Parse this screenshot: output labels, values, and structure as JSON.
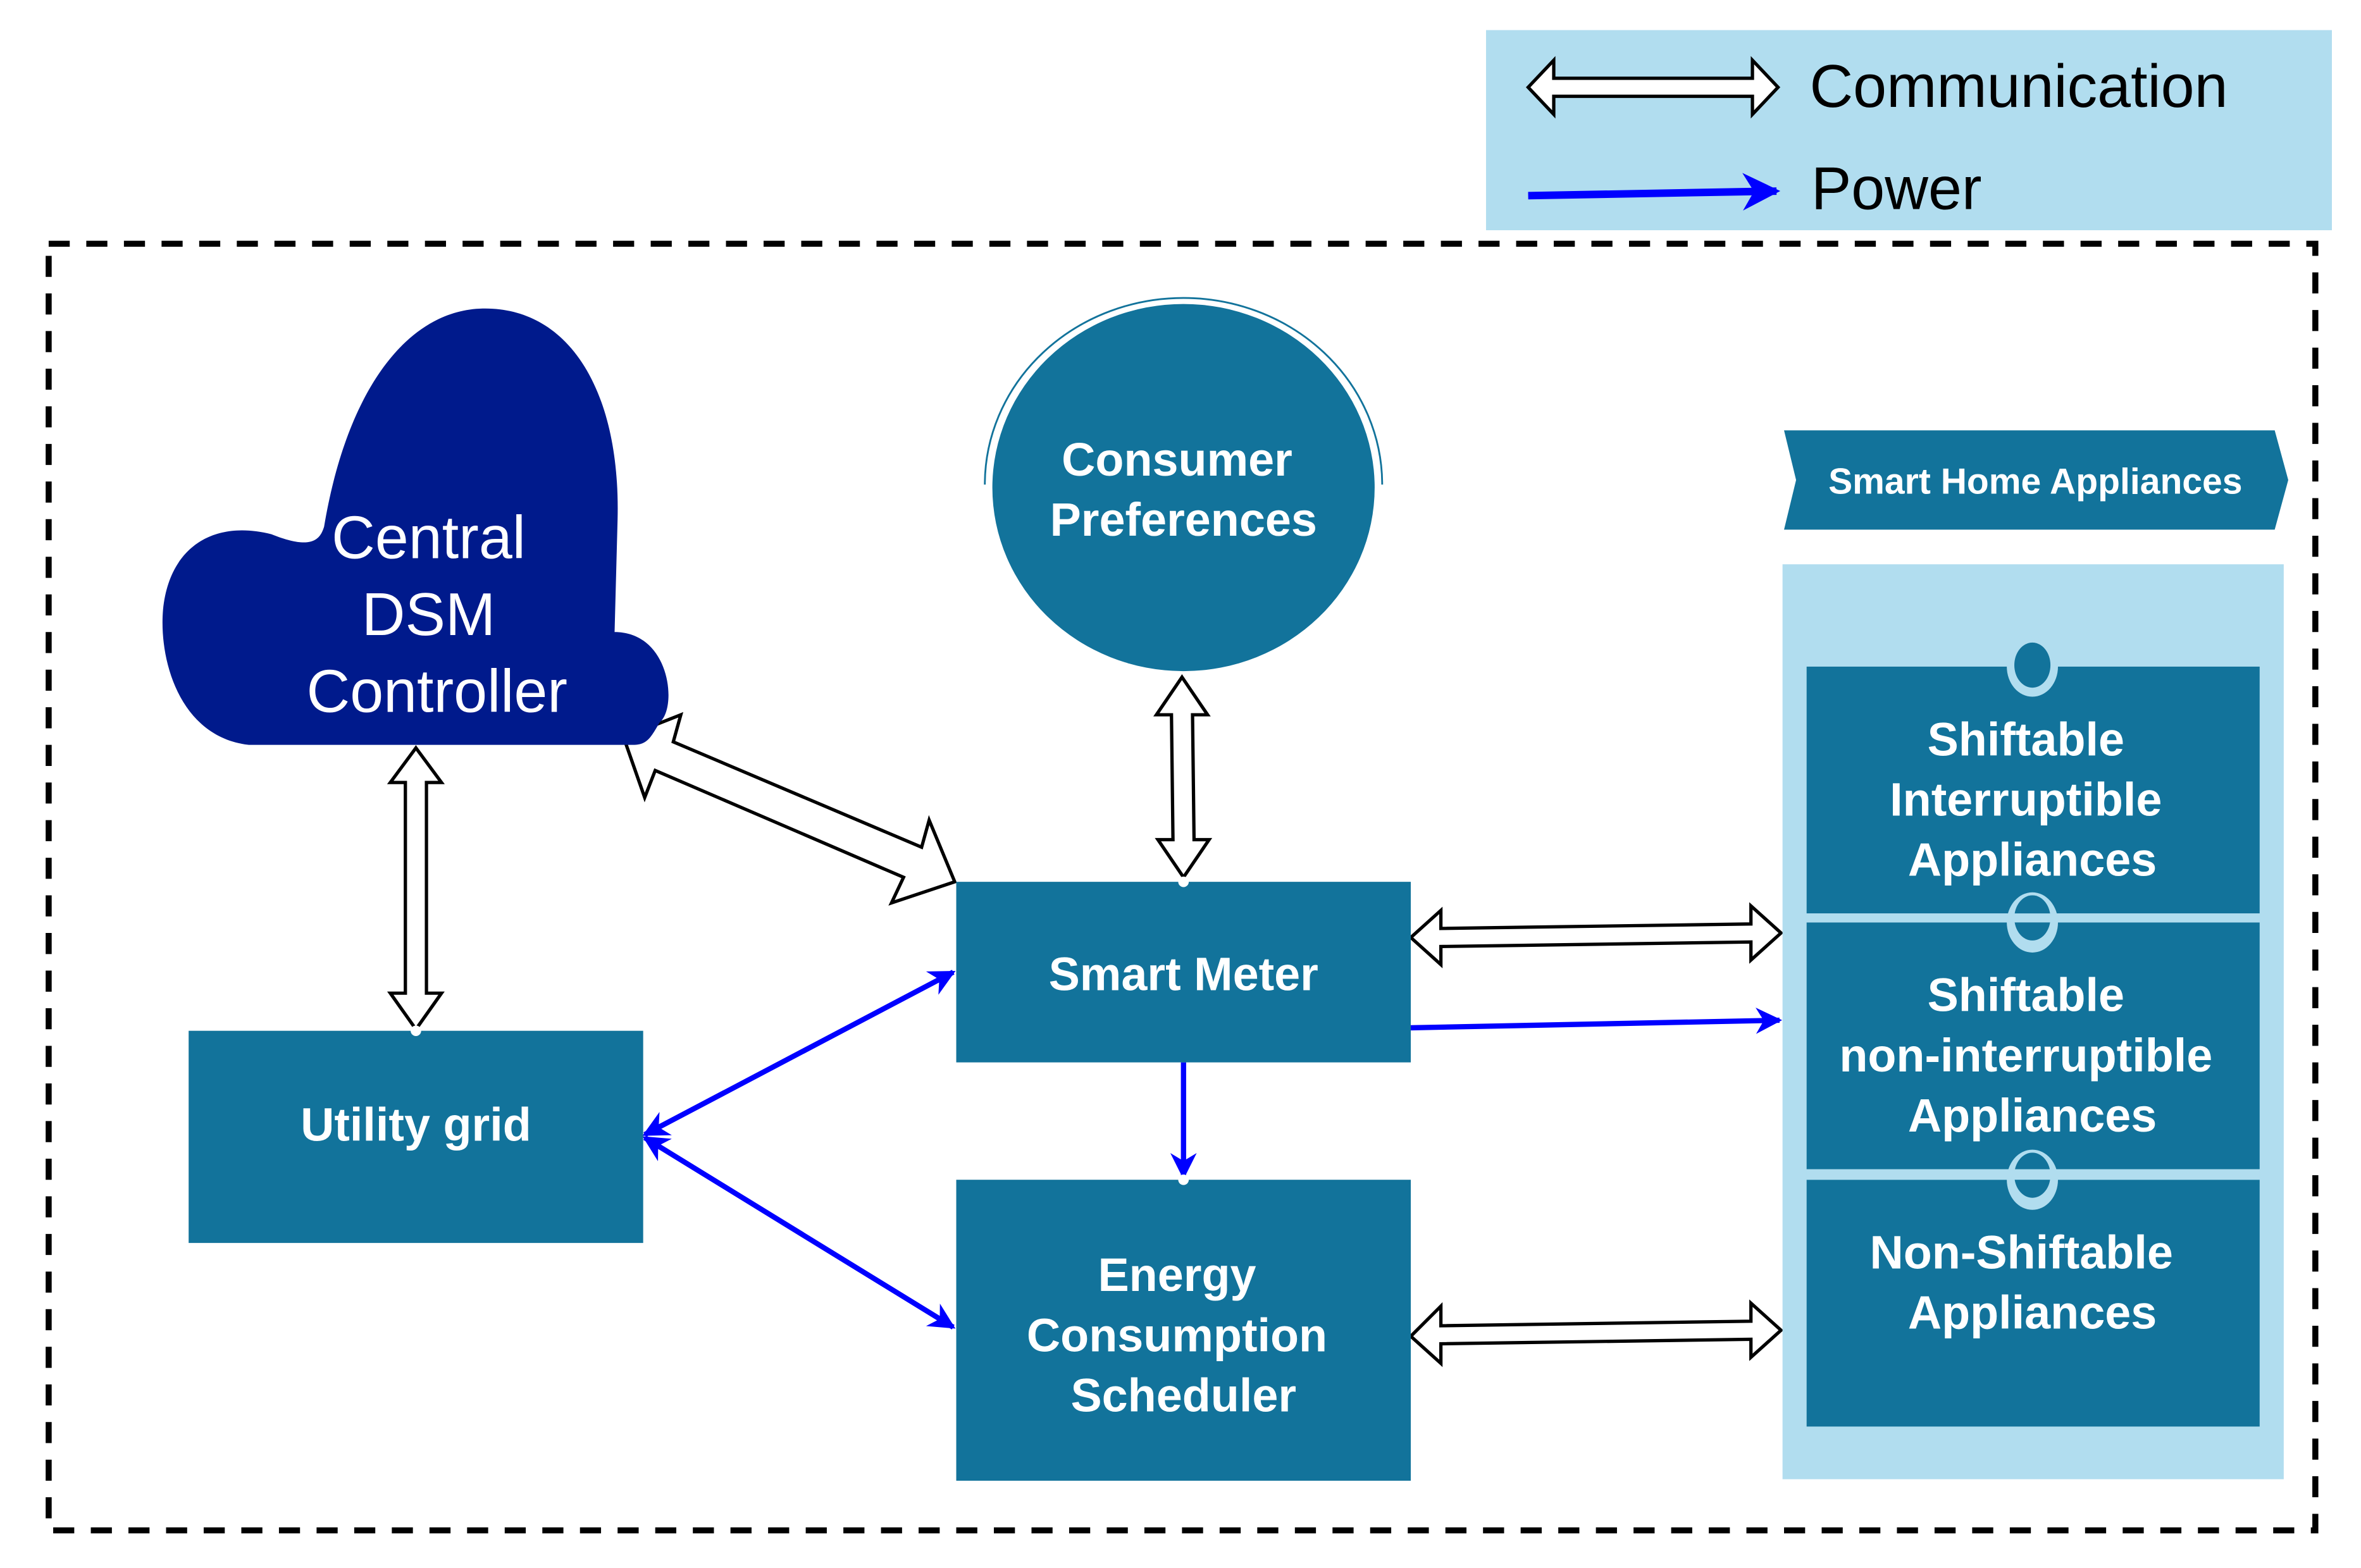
{
  "colors": {
    "box_fill": "#12739b",
    "cloud_fill": "#001a8c",
    "light_panel": "#b1ddef",
    "power_arrow": "#0000ff",
    "comm_arrow_stroke": "#000000",
    "text_white": "#ffffff",
    "text_black": "#000000"
  },
  "legend": {
    "communication_label": "Communication",
    "power_label": "Power"
  },
  "nodes": {
    "central_controller": {
      "lines": [
        "Central",
        "DSM",
        "Controller"
      ]
    },
    "consumer_preferences": {
      "lines": [
        "Consumer",
        "Preferences"
      ]
    },
    "smart_meter": {
      "lines": [
        "Smart Meter"
      ]
    },
    "utility_grid": {
      "lines": [
        "Utility grid"
      ]
    },
    "energy_scheduler": {
      "lines": [
        "Energy",
        "Consumption",
        "Scheduler"
      ]
    }
  },
  "appliances": {
    "header": "Smart Home Appliances",
    "items": [
      {
        "lines": [
          "Shiftable",
          "Interruptible",
          "Appliances"
        ]
      },
      {
        "lines": [
          "Shiftable",
          "non-interruptible",
          "Appliances"
        ]
      },
      {
        "lines": [
          "Non-Shiftable",
          "Appliances"
        ]
      }
    ]
  },
  "connections": [
    {
      "from": "central_controller",
      "to": "utility_grid",
      "type": "communication",
      "direction": "bidirectional"
    },
    {
      "from": "central_controller",
      "to": "smart_meter",
      "type": "communication",
      "direction": "bidirectional"
    },
    {
      "from": "consumer_preferences",
      "to": "smart_meter",
      "type": "communication",
      "direction": "bidirectional"
    },
    {
      "from": "smart_meter",
      "to": "appliances",
      "type": "communication",
      "direction": "bidirectional"
    },
    {
      "from": "smart_meter",
      "to": "appliances",
      "type": "power",
      "direction": "forward"
    },
    {
      "from": "utility_grid",
      "to": "smart_meter",
      "type": "power",
      "direction": "bidirectional"
    },
    {
      "from": "utility_grid",
      "to": "energy_scheduler",
      "type": "power",
      "direction": "bidirectional"
    },
    {
      "from": "smart_meter",
      "to": "energy_scheduler",
      "type": "power",
      "direction": "forward"
    },
    {
      "from": "energy_scheduler",
      "to": "appliances",
      "type": "communication",
      "direction": "bidirectional"
    }
  ]
}
